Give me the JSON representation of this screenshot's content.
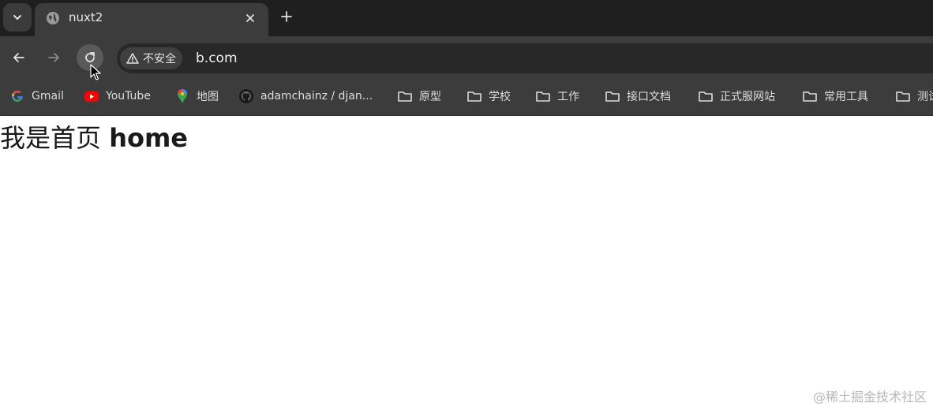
{
  "tabs": [
    {
      "title": "nuxt2",
      "active": true
    }
  ],
  "icons": {
    "tab_search": "chevron-down-icon",
    "tab_close": "close-icon",
    "new_tab": "plus-icon",
    "back": "arrow-left-icon",
    "forward": "arrow-right-icon",
    "reload": "reload-icon",
    "security": "warning-triangle-icon"
  },
  "toolbar": {
    "security_label": "不安全",
    "url": "b.com"
  },
  "bookmarks": [
    {
      "label": "Gmail",
      "icon": "google-icon"
    },
    {
      "label": "YouTube",
      "icon": "youtube-icon"
    },
    {
      "label": "地图",
      "icon": "maps-pin-icon"
    },
    {
      "label": "adamchainz / djan...",
      "icon": "github-icon"
    },
    {
      "label": "原型",
      "icon": "folder-icon"
    },
    {
      "label": "学校",
      "icon": "folder-icon"
    },
    {
      "label": "工作",
      "icon": "folder-icon"
    },
    {
      "label": "接口文档",
      "icon": "folder-icon"
    },
    {
      "label": "正式服网站",
      "icon": "folder-icon"
    },
    {
      "label": "常用工具",
      "icon": "folder-icon"
    },
    {
      "label": "测试",
      "icon": "folder-icon"
    }
  ],
  "page": {
    "heading_cn": "我是首页",
    "heading_en": "home",
    "watermark": "@稀土掘金技术社区"
  },
  "colors": {
    "tabstrip_bg": "#1f1f1f",
    "toolbar_bg": "#3c3c3c",
    "omnibox_bg": "#282828",
    "page_bg": "#ffffff"
  }
}
